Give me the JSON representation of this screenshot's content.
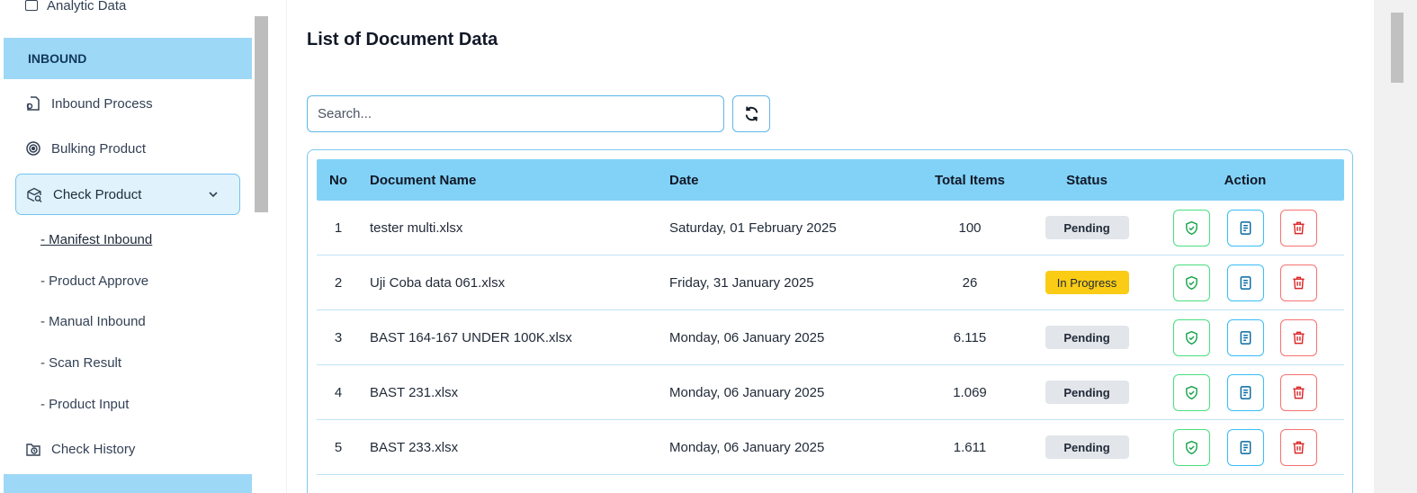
{
  "sidebar": {
    "cut_item": "Analytic Data",
    "section_title": "INBOUND",
    "items": [
      {
        "label": "Inbound Process",
        "icon": "inbound-process-icon"
      },
      {
        "label": "Bulking Product",
        "icon": "bulking-icon"
      },
      {
        "label": "Check Product",
        "icon": "check-product-icon",
        "expanded": true
      },
      {
        "label": "Check History",
        "icon": "check-history-icon"
      }
    ],
    "sub_items": [
      {
        "label": "- Manifest Inbound",
        "current": true
      },
      {
        "label": "- Product Approve"
      },
      {
        "label": "- Manual Inbound"
      },
      {
        "label": "- Scan Result"
      },
      {
        "label": "- Product Input"
      }
    ]
  },
  "main": {
    "title": "List of Document Data",
    "search": {
      "placeholder": "Search...",
      "value": ""
    },
    "table": {
      "columns": [
        "No",
        "Document Name",
        "Date",
        "Total Items",
        "Status",
        "Action"
      ],
      "rows": [
        {
          "no": "1",
          "name": "tester multi.xlsx",
          "date": "Saturday, 01 February 2025",
          "total": "100",
          "status": "Pending"
        },
        {
          "no": "2",
          "name": "Uji Coba data 061.xlsx",
          "date": "Friday, 31 January 2025",
          "total": "26",
          "status": "In Progress"
        },
        {
          "no": "3",
          "name": "BAST 164-167 UNDER 100K.xlsx",
          "date": "Monday, 06 January 2025",
          "total": "6.115",
          "status": "Pending"
        },
        {
          "no": "4",
          "name": "BAST 231.xlsx",
          "date": "Monday, 06 January 2025",
          "total": "1.069",
          "status": "Pending"
        },
        {
          "no": "5",
          "name": "BAST 233.xlsx",
          "date": "Monday, 06 January 2025",
          "total": "1.611",
          "status": "Pending"
        }
      ]
    }
  },
  "colors": {
    "accent": "#82d2f7",
    "section_bg": "#9ed8f7",
    "pending_badge": "#e2e5e9",
    "in_progress_badge": "#facc15",
    "approve": "#4ade80",
    "detail": "#38bdf8",
    "delete": "#f87171"
  }
}
